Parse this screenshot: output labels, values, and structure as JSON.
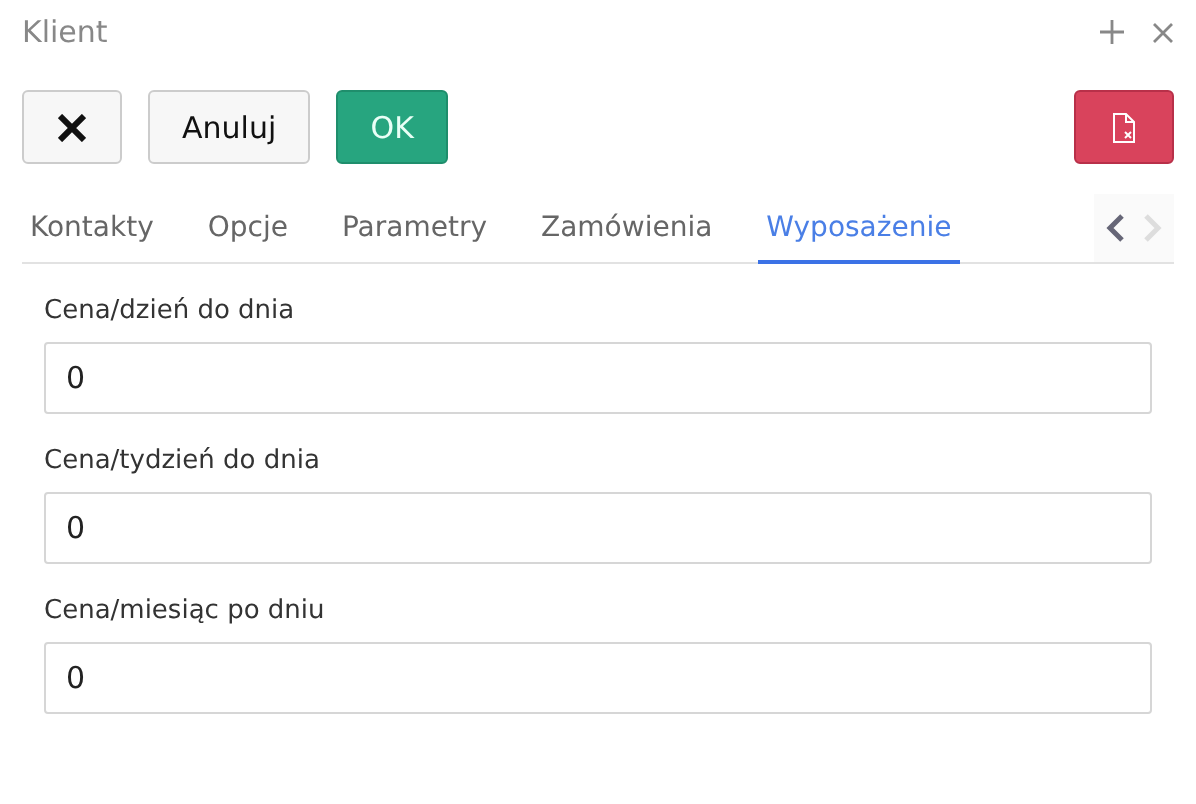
{
  "window": {
    "title": "Klient"
  },
  "title_actions": [
    {
      "kind": "add"
    },
    {
      "kind": "close"
    }
  ],
  "toolbar": [
    {
      "kind": "close"
    },
    {
      "kind": "text",
      "label": "Anuluj"
    },
    {
      "kind": "ok",
      "label": "OK"
    }
  ],
  "danger_action": {
    "kind": "delete-file"
  },
  "tabs": [
    {
      "label": "Kontakty",
      "selected": false
    },
    {
      "label": "Opcje",
      "selected": false
    },
    {
      "label": "Parametry",
      "selected": false
    },
    {
      "label": "Zamówienia",
      "selected": false
    },
    {
      "label": "Wyposażenie",
      "selected": true
    }
  ],
  "tab_scroll": [
    {
      "kind": "left",
      "disabled": false
    },
    {
      "kind": "right",
      "disabled": true
    }
  ],
  "fields": [
    {
      "label": "Cena/dzień do dnia",
      "value": "0"
    },
    {
      "label": "Cena/tydzień do dnia",
      "value": "0"
    },
    {
      "label": "Cena/miesiąc po dniu",
      "value": "0"
    }
  ]
}
